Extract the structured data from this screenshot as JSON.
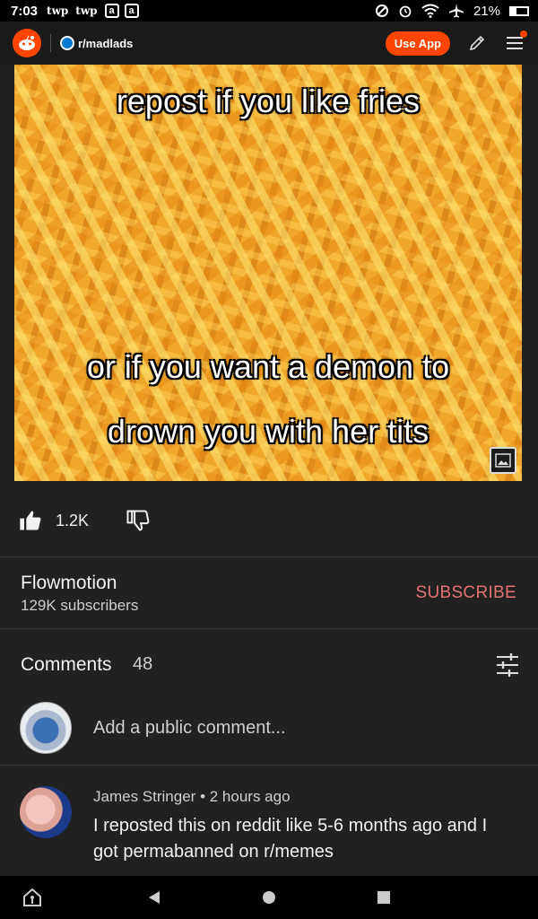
{
  "status_bar": {
    "time": "7:03",
    "notif_icons": [
      "twp",
      "twp"
    ],
    "app_badges": [
      "a",
      "a"
    ],
    "battery": "21%",
    "battery_level": 0.21
  },
  "reddit_header": {
    "subreddit": "r/madlads",
    "use_app_label": "Use App",
    "brand_color": "#ff4500"
  },
  "post": {
    "caption_lines": [
      "repost if you like fries",
      "or if you want a demon to",
      "drown you with her tits"
    ]
  },
  "actions": {
    "like_count": "1.2K"
  },
  "channel": {
    "name": "Flowmotion",
    "subscribers": "129K subscribers",
    "subscribe_label": "SUBSCRIBE",
    "subscribe_color": "#e57373"
  },
  "comments": {
    "title": "Comments",
    "count": "48",
    "add_placeholder": "Add a public comment...",
    "items": [
      {
        "author": "James Stringer",
        "time": "2 hours ago",
        "text": "I reposted this on reddit like 5-6 months ago and I got permabanned on r/memes"
      }
    ]
  }
}
